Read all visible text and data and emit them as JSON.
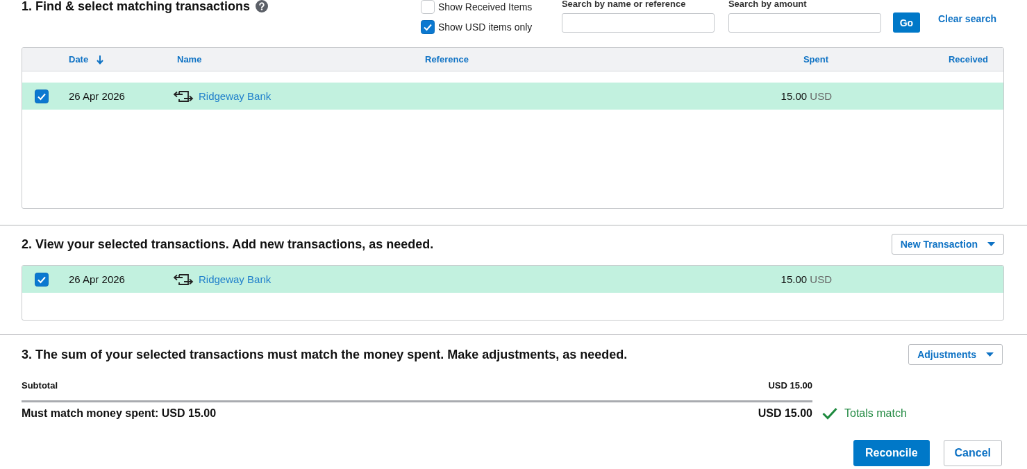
{
  "find_section": {
    "title": "1. Find & select matching transactions",
    "filters": [
      {
        "label": "Show Received Items",
        "checked": false
      },
      {
        "label": "Show USD items only",
        "checked": true
      }
    ],
    "search_fields": [
      {
        "label": "Search by name or reference"
      },
      {
        "label": "Search by amount"
      }
    ],
    "go_button": "Go",
    "clear_search": "Clear search",
    "table": {
      "columns": [
        {
          "label": "Date",
          "sorted": true
        },
        {
          "label": "Name",
          "sorted": false
        },
        {
          "label": "Reference",
          "sorted": false
        },
        {
          "label": "Spent",
          "sorted": false
        },
        {
          "label": "Received",
          "sorted": false
        }
      ],
      "rows": [
        {
          "kind": "transfer",
          "checked": true,
          "date": "26 Apr 2026",
          "name": "Ridgeway Bank",
          "spent": "15.00",
          "currency": "USD"
        }
      ]
    }
  },
  "selected_section": {
    "title": "2. View your selected transactions. Add new transactions, as needed.",
    "new_transaction_button": "New Transaction",
    "rows": [
      {
        "kind": "transfer",
        "checked": true,
        "date": "26 Apr 2026",
        "name": "Ridgeway Bank",
        "spent": "15.00",
        "currency": "USD"
      }
    ]
  },
  "adjust_section": {
    "title": "3. The sum of your selected transactions must match the money spent. Make adjustments, as needed.",
    "adjustments_button": "Adjustments",
    "summary": {
      "subtotal_label": "Subtotal",
      "subtotal_amount": "USD 15.00",
      "must_match_label": "Must match money spent: USD 15.00",
      "must_match_amount": "USD 15.00",
      "matched": true,
      "status": "Totals match"
    },
    "actions": [
      {
        "kind": "primary",
        "label": "Reconcile"
      },
      {
        "kind": "secondary",
        "label": "Cancel"
      }
    ]
  }
}
